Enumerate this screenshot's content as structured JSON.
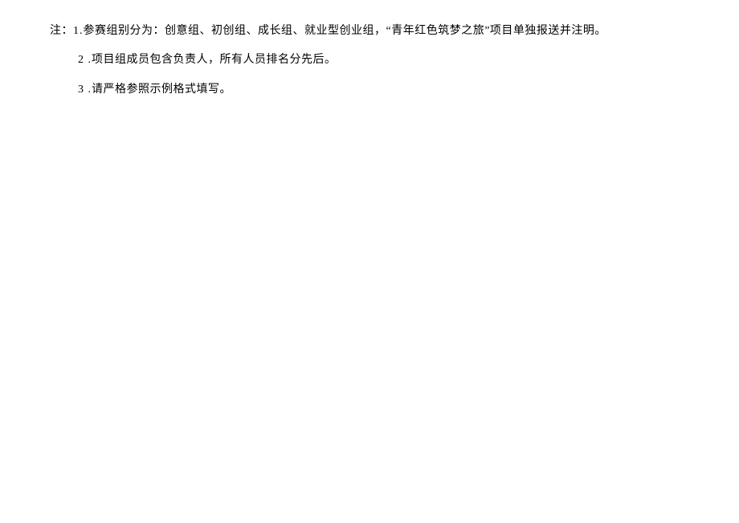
{
  "notes": {
    "label": "注：",
    "item1_num": "1.",
    "item1_text": "参赛组别分为：创意组、初创组、成长组、就业型创业组，“青年红色筑梦之旅”项目单独报送并注明。",
    "item2_num": "2 .",
    "item2_text": "项目组成员包含负责人，所有人员排名分先后。",
    "item3_num": "3 .",
    "item3_text": "请严格参照示例格式填写。"
  }
}
